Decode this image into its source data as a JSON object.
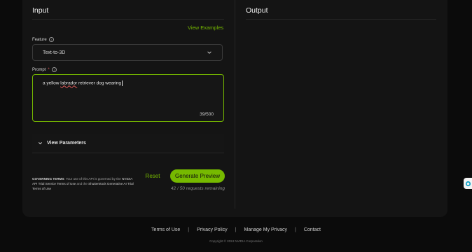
{
  "input": {
    "title": "Input",
    "view_examples": "View Examples",
    "feature": {
      "label": "Feature",
      "info_icon": "info-icon",
      "value": "Text-to-3D"
    },
    "prompt": {
      "label": "Prompt",
      "required_mark": "*",
      "info_icon": "info-icon",
      "value_before": "a yellow ",
      "value_misspelled": "labrador",
      "value_after": " retriever dog wearing",
      "counter": "39/500"
    },
    "parameters": {
      "label": "View Parameters",
      "icon": "chevron-down-icon"
    },
    "terms": {
      "heading": "GOVERNING TERMS",
      "text1": ": Your use of this API is governed by the ",
      "link1": "NVIDIA API Trial Service Terms of Use",
      "text2": " and the ",
      "link2": "Shutterstock Generative AI Trial Terms of Use"
    },
    "reset_label": "Reset",
    "generate_label": "Generate Preview",
    "remaining": "42 / 50 requests remaining"
  },
  "output": {
    "title": "Output"
  },
  "footer": {
    "links": [
      "Terms of Use",
      "Privacy Policy",
      "Manage My Privacy",
      "Contact"
    ],
    "separator": "|",
    "copyright": "Copyright © 2024 NVIDIA Corporation"
  },
  "colors": {
    "accent": "#76b900",
    "background": "#0b0b0b",
    "panel": "#141414"
  }
}
